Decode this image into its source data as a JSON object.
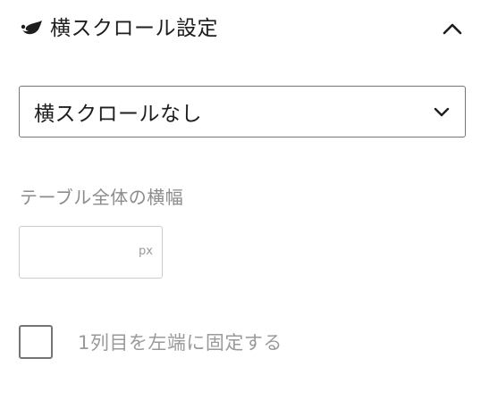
{
  "panel": {
    "title": "横スクロール設定",
    "brand_icon": "leaf-icon",
    "toggle_icon": "chevron-up-icon",
    "expanded": true
  },
  "scroll_select": {
    "selected": "横スクロールなし",
    "icon": "chevron-down-icon"
  },
  "table_width": {
    "label": "テーブル全体の横幅",
    "value": "",
    "unit": "px"
  },
  "fix_first_column": {
    "label": "1列目を左端に固定する",
    "checked": false
  },
  "colors": {
    "text": "#1e1e1e",
    "muted": "#8c8c8c",
    "border": "#757575",
    "border_light": "#cccccc"
  }
}
